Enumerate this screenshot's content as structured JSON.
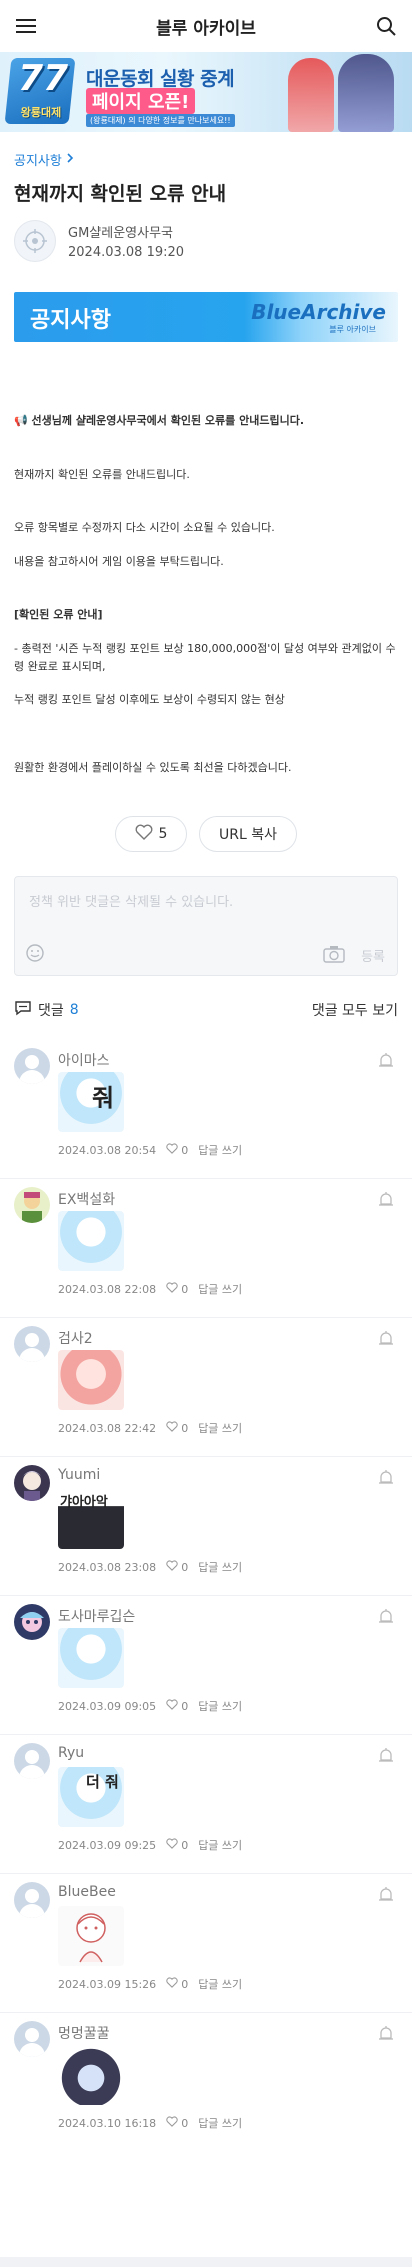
{
  "header": {
    "title": "블루 아카이브"
  },
  "banner": {
    "logo_number": "77",
    "logo_sub": "왕룡대제",
    "line1": "대운동회 실황 중계",
    "line2": "페이지 오픈!",
    "line3": "(왕룡대제) 의 다양한 정보를 만나보세요!!"
  },
  "breadcrumb": "공지사항",
  "post": {
    "title": "현재까지 확인된 오류 안내",
    "author": "GM샬레운영사무국",
    "date": "2024.03.08 19:20"
  },
  "notice_banner": {
    "left": "공지사항",
    "right": "BlueArchive",
    "sub": "블루 아카이브"
  },
  "body": {
    "p1": "📢 선생님께 샬레운영사무국에서 확인된 오류를 안내드립니다.",
    "p2": "현재까지 확인된 오류를 안내드립니다.",
    "p3": "오류 항목별로 수정까지 다소 시간이 소요될 수 있습니다.",
    "p4": "내용을 참고하시어 게임 이용을 부탁드립니다.",
    "section_title": "[확인된 오류 안내]",
    "item1": "- 총력전 '시즌 누적 랭킹 포인트 보상 180,000,000점'이 달성 여부와 관계없이 수령 완료로 표시되며,",
    "item2": " 누적 랭킹 포인트 달성 이후에도 보상이 수령되지 않는 현상",
    "closing": "원활한 환경에서 플레이하실 수 있도록 최선을 다하겠습니다."
  },
  "actions": {
    "likes": "5",
    "copy_url": "URL 복사"
  },
  "comment_box": {
    "placeholder": "정책 위반 댓글은 삭제될 수 있습니다.",
    "submit": "등록"
  },
  "comments_head": {
    "label": "댓글",
    "count": "8",
    "view_all": "댓글 모두 보기"
  },
  "comments": [
    {
      "name": "아이마스",
      "sticker_text": "줘",
      "date": "2024.03.08 20:54",
      "likes": "0",
      "reply": "답글 쓰기"
    },
    {
      "name": "EX백설화",
      "sticker_text": "",
      "date": "2024.03.08 22:08",
      "likes": "0",
      "reply": "답글 쓰기"
    },
    {
      "name": "검사2",
      "sticker_text": "",
      "date": "2024.03.08 22:42",
      "likes": "0",
      "reply": "답글 쓰기"
    },
    {
      "name": "Yuumi",
      "sticker_text": "갸아아악",
      "date": "2024.03.08 23:08",
      "likes": "0",
      "reply": "답글 쓰기"
    },
    {
      "name": "도사마루깁슨",
      "sticker_text": "",
      "date": "2024.03.09 09:05",
      "likes": "0",
      "reply": "답글 쓰기"
    },
    {
      "name": "Ryu",
      "sticker_text": "더 줘",
      "date": "2024.03.09 09:25",
      "likes": "0",
      "reply": "답글 쓰기"
    },
    {
      "name": "BlueBee",
      "sticker_text": "",
      "date": "2024.03.09 15:26",
      "likes": "0",
      "reply": "답글 쓰기"
    },
    {
      "name": "멍멍꿀꿀",
      "sticker_text": "",
      "date": "2024.03.10 16:18",
      "likes": "0",
      "reply": "답글 쓰기"
    }
  ],
  "colors": {
    "accent": "#1f7fd6",
    "notice_blue": "#2b9cec",
    "meta": "#888888"
  }
}
